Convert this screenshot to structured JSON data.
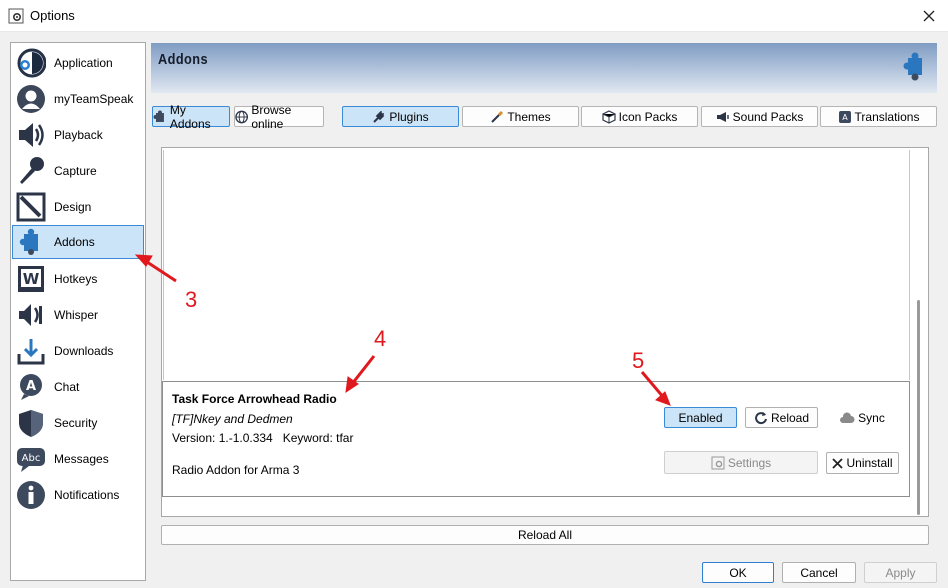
{
  "window": {
    "title": "Options",
    "close_icon": "close-icon"
  },
  "sidebar": {
    "items": [
      {
        "label": "Application",
        "icon": "application-icon"
      },
      {
        "label": "myTeamSpeak",
        "icon": "user-icon"
      },
      {
        "label": "Playback",
        "icon": "speaker-icon"
      },
      {
        "label": "Capture",
        "icon": "microphone-icon"
      },
      {
        "label": "Design",
        "icon": "design-icon"
      },
      {
        "label": "Addons",
        "icon": "puzzle-icon",
        "selected": true
      },
      {
        "label": "Hotkeys",
        "icon": "keyboard-icon"
      },
      {
        "label": "Whisper",
        "icon": "whisper-icon"
      },
      {
        "label": "Downloads",
        "icon": "download-icon"
      },
      {
        "label": "Chat",
        "icon": "chat-icon"
      },
      {
        "label": "Security",
        "icon": "shield-icon"
      },
      {
        "label": "Messages",
        "icon": "messages-icon"
      },
      {
        "label": "Notifications",
        "icon": "info-icon"
      }
    ]
  },
  "header": {
    "title": "Addons",
    "icon": "puzzle-icon"
  },
  "source_tabs": [
    {
      "label": "My Addons",
      "active": true
    },
    {
      "label": "Browse online",
      "active": false
    }
  ],
  "type_tabs": [
    {
      "label": "Plugins",
      "active": true
    },
    {
      "label": "Themes",
      "active": false
    },
    {
      "label": "Icon Packs",
      "active": false
    },
    {
      "label": "Sound Packs",
      "active": false
    },
    {
      "label": "Translations",
      "active": false
    }
  ],
  "addon": {
    "name": "Task Force Arrowhead Radio",
    "authors": "[TF]Nkey and Dedmen",
    "version_label": "Version: 1.-1.0.334",
    "keyword_label": "Keyword: tfar",
    "description": "Radio Addon for Arma 3",
    "enabled_label": "Enabled",
    "reload_label": "Reload",
    "sync_label": "Sync",
    "settings_label": "Settings",
    "uninstall_label": "Uninstall"
  },
  "reload_all_label": "Reload All",
  "footer": {
    "ok": "OK",
    "cancel": "Cancel",
    "apply": "Apply"
  },
  "annotations": [
    "3",
    "4",
    "5"
  ],
  "colors": {
    "accent": "#3a8ad6",
    "selected_bg": "#cce4f7",
    "annotation": "#e0191e",
    "banner_dark": "#7f9cc3"
  }
}
